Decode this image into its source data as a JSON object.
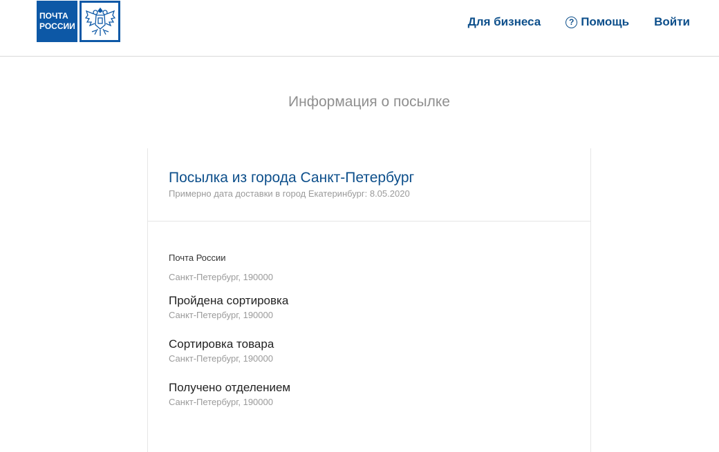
{
  "header": {
    "logo": {
      "line1": "ПОЧТА",
      "line2": "РОССИИ",
      "emblem_icon": "double-headed-eagle-icon"
    },
    "nav": {
      "business": "Для бизнеса",
      "help_icon": "question-circle-icon",
      "help": "Помощь",
      "login": "Войти"
    }
  },
  "page": {
    "title": "Информация о посылке"
  },
  "parcel": {
    "title": "Посылка из города Санкт-Петербург",
    "subtitle": "Примерно дата доставки в город Екатеринбург: 8.05.2020",
    "events": [
      {
        "title": "Почта России",
        "place": "Санкт-Петербург, 190000"
      },
      {
        "title": "Пройдена сортировка",
        "place": "Санкт-Петербург, 190000"
      },
      {
        "title": "Сортировка товара",
        "place": "Санкт-Петербург, 190000"
      },
      {
        "title": "Получено отделением",
        "place": "Санкт-Петербург, 190000"
      }
    ]
  },
  "colors": {
    "brand_blue": "#0d58a6",
    "link_blue": "#0d4f8b",
    "muted_gray": "#9a9a9a"
  }
}
